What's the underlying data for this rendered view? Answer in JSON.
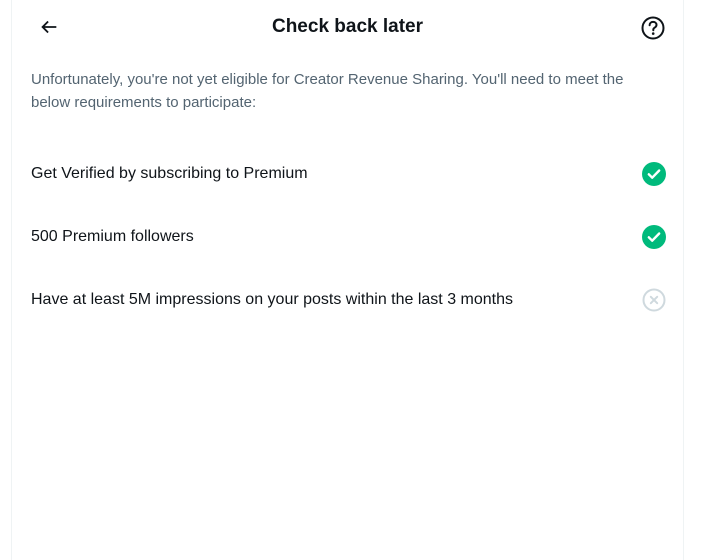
{
  "header": {
    "title": "Check back later",
    "back_icon": "arrow-left-icon",
    "help_icon": "question-circle-icon"
  },
  "intro": "Unfortunately, you're not yet eligible for Creator Revenue Sharing. You'll need to meet the below requirements to participate:",
  "requirements": [
    {
      "label": "Get Verified by subscribing to Premium",
      "met": true,
      "icon": "check-circle-icon"
    },
    {
      "label": "500 Premium followers",
      "met": true,
      "icon": "check-circle-icon"
    },
    {
      "label": "Have at least 5M impressions on your posts within the last 3 months",
      "met": false,
      "icon": "x-circle-icon"
    }
  ],
  "colors": {
    "met": "#00ba7c",
    "unmet": "#cfd9de",
    "text": "#0f1419",
    "secondary_text": "#536471"
  }
}
